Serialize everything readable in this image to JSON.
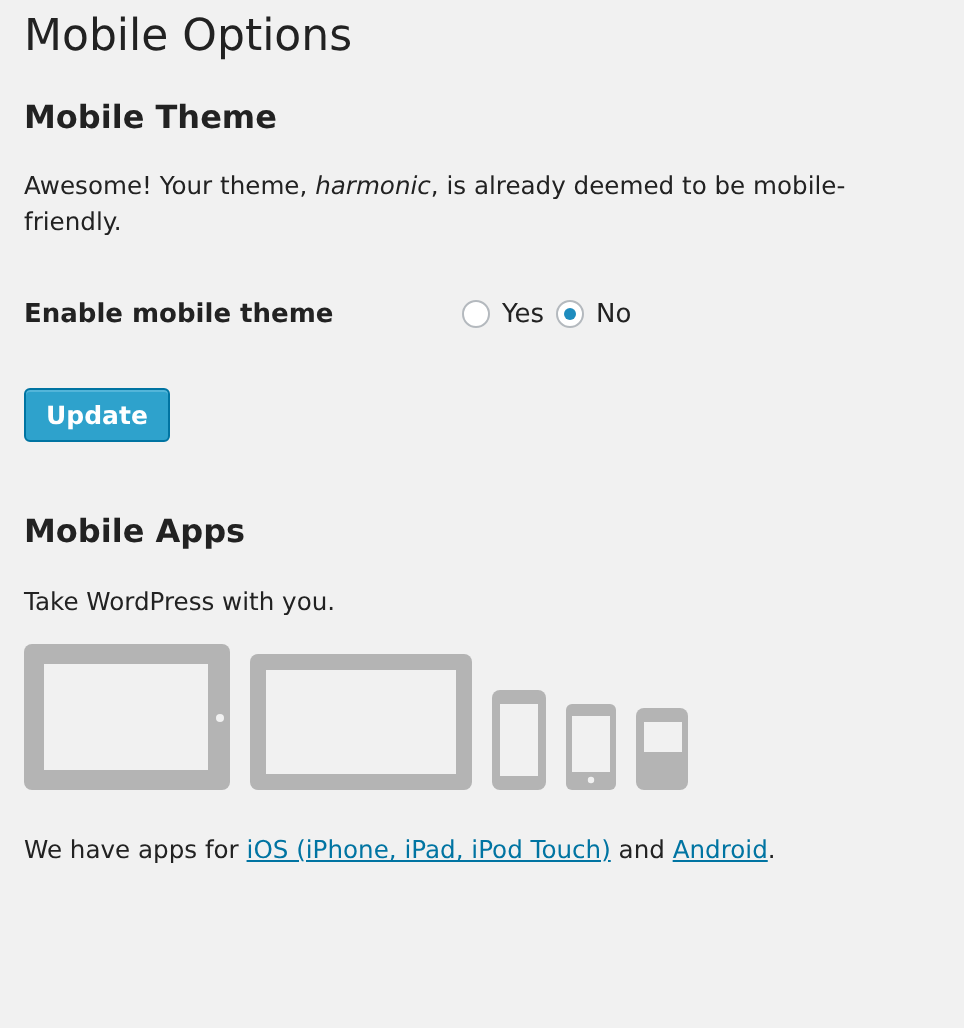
{
  "page_title": "Mobile Options",
  "mobile_theme": {
    "heading": "Mobile Theme",
    "message": "Awesome! Your theme, *harmonic*, is already deemed to be mobile-friendly.",
    "setting": {
      "label": "Enable mobile theme",
      "options": [
        {
          "label": "Yes",
          "selected": false
        },
        {
          "label": "No",
          "selected": true
        }
      ]
    },
    "button": "Update"
  },
  "mobile_apps": {
    "heading": "Mobile Apps",
    "intro": "Take WordPress with you.",
    "apps_text": [
      {
        "kind": "text",
        "text": "We have apps for "
      },
      {
        "kind": "link",
        "text": "iOS (iPhone, iPad, iPod Touch)"
      },
      {
        "kind": "text",
        "text": " and "
      },
      {
        "kind": "link",
        "text": "Android"
      },
      {
        "kind": "text",
        "text": "."
      }
    ]
  }
}
